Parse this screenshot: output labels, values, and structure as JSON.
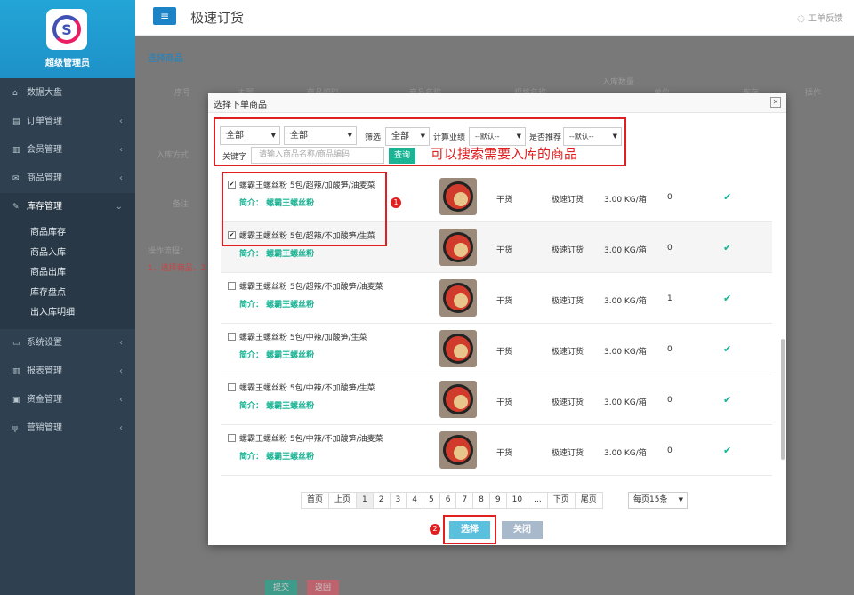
{
  "sidebar": {
    "admin_label": "超级管理员",
    "items": [
      {
        "label": "数据大盘",
        "icon": "home-icon"
      },
      {
        "label": "订单管理",
        "icon": "list-icon"
      },
      {
        "label": "会员管理",
        "icon": "chart-icon"
      },
      {
        "label": "商品管理",
        "icon": "mail-icon"
      },
      {
        "label": "库存管理",
        "icon": "edit-icon"
      },
      {
        "label": "系统设置",
        "icon": "desktop-icon"
      },
      {
        "label": "报表管理",
        "icon": "chart-icon"
      },
      {
        "label": "资金管理",
        "icon": "money-icon"
      },
      {
        "label": "营销管理",
        "icon": "cutlery-icon"
      }
    ],
    "sub_items": [
      "商品库存",
      "商品入库",
      "商品出库",
      "库存盘点",
      "出入库明细"
    ]
  },
  "topbar": {
    "title": "极速订货",
    "feedback": "工单反馈"
  },
  "background": {
    "section_title": "选择商品",
    "col_serial": "序号",
    "col_image": "主图",
    "col_code": "商品编码",
    "col_name": "商品名称",
    "col_spec": "规格名称",
    "col_qty": "入库数量",
    "col_unit": "单位",
    "col_stock": "库存",
    "col_op": "操作",
    "label_method": "入库方式",
    "label_remark": "备注",
    "op_flow": "操作流程：",
    "op_step": "1，选择商品，2",
    "btn_submit": "提交",
    "btn_back": "返回"
  },
  "modal": {
    "title": "选择下单商品",
    "filter": {
      "sel1": "全部",
      "sel2": "全部",
      "screen_label": "筛选",
      "sel3": "全部",
      "calc_label": "计算业绩",
      "sel4": "--默认--",
      "recommend_label": "是否推荐",
      "sel5": "--默认--",
      "keyword_label": "关键字",
      "keyword_placeholder": "请输入商品名称/商品编码",
      "query_button": "查询"
    },
    "annotation": "可以搜索需要入库的商品",
    "badge1": "1",
    "badge2": "2",
    "rows": [
      {
        "name": "螺霸王螺丝粉 5包/超辣/加酸笋/油麦菜",
        "brief": "简介： 螺霸王螺丝粉",
        "type": "干货",
        "channel": "极速订货",
        "spec": "3.00 KG/箱",
        "stock": "0",
        "checked": "✔"
      },
      {
        "name": "螺霸王螺丝粉 5包/超辣/不加酸笋/生菜",
        "brief": "简介： 螺霸王螺丝粉",
        "type": "干货",
        "channel": "极速订货",
        "spec": "3.00 KG/箱",
        "stock": "0",
        "checked": "✔"
      },
      {
        "name": "螺霸王螺丝粉 5包/超辣/不加酸笋/油麦菜",
        "brief": "简介： 螺霸王螺丝粉",
        "type": "干货",
        "channel": "极速订货",
        "spec": "3.00 KG/箱",
        "stock": "1",
        "checked": ""
      },
      {
        "name": "螺霸王螺丝粉 5包/中辣/加酸笋/生菜",
        "brief": "简介： 螺霸王螺丝粉",
        "type": "干货",
        "channel": "极速订货",
        "spec": "3.00 KG/箱",
        "stock": "0",
        "checked": ""
      },
      {
        "name": "螺霸王螺丝粉 5包/中辣/不加酸笋/生菜",
        "brief": "简介： 螺霸王螺丝粉",
        "type": "干货",
        "channel": "极速订货",
        "spec": "3.00 KG/箱",
        "stock": "0",
        "checked": ""
      },
      {
        "name": "螺霸王螺丝粉 5包/中辣/不加酸笋/油麦菜",
        "brief": "简介： 螺霸王螺丝粉",
        "type": "干货",
        "channel": "极速订货",
        "spec": "3.00 KG/箱",
        "stock": "0",
        "checked": ""
      }
    ],
    "status_mark": "✔",
    "pagination": [
      "首页",
      "上页",
      "1",
      "2",
      "3",
      "4",
      "5",
      "6",
      "7",
      "8",
      "9",
      "10",
      "...",
      "下页",
      "尾页"
    ],
    "per_page": "每页15条",
    "select_button": "选择",
    "close_button": "关闭",
    "colors": {
      "accent": "#1ab394",
      "annotation": "#e02020",
      "select": "#5bc0de"
    }
  }
}
